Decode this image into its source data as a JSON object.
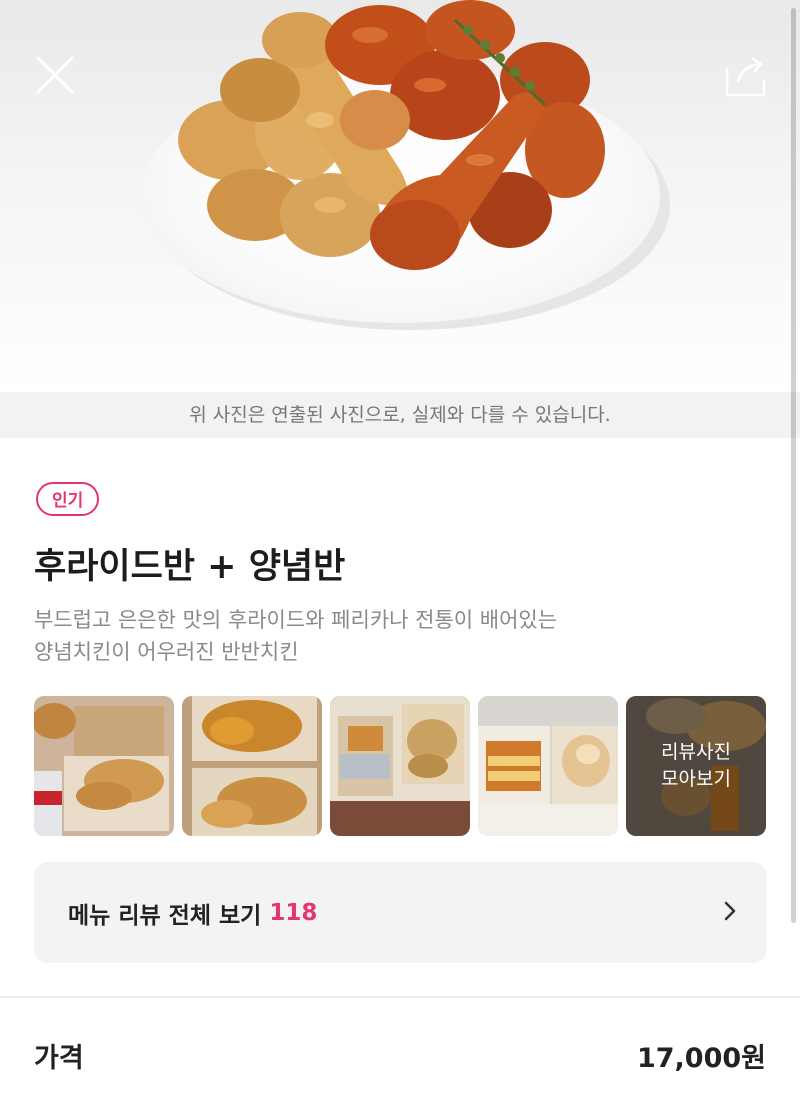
{
  "header": {
    "close_icon": "close-icon",
    "share_icon": "share-icon"
  },
  "hero": {
    "caption": "위 사진은 연출된 사진으로, 실제와 다를 수 있습니다."
  },
  "menu": {
    "badge": "인기",
    "title": "후라이드반 + 양념반",
    "description_lines": [
      "부드럽고 은은한 맛의 후라이드와 페리카나 전통이 배어있는",
      "양념치킨이 어우러진 반반치킨"
    ]
  },
  "review_photos": {
    "more_lines": [
      "리뷰사진",
      "모아보기"
    ]
  },
  "review_link": {
    "label": "메뉴 리뷰 전체 보기",
    "count": "118",
    "chevron_icon": "chevron-right-icon"
  },
  "price": {
    "label": "가격",
    "value": "17,000원"
  },
  "colors": {
    "accent": "#e5356e",
    "caption_bg": "#f2f2f2",
    "card_bg": "#f3f3f3"
  }
}
